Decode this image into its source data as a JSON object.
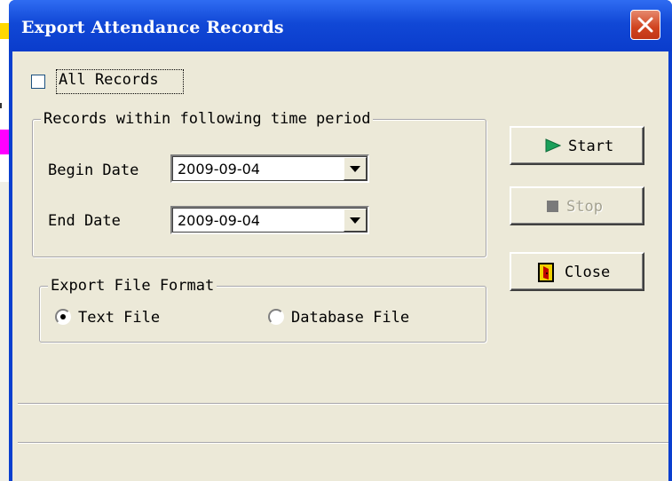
{
  "window": {
    "title": "Export Attendance Records"
  },
  "all_records": {
    "label": "All Records",
    "checked": false
  },
  "time_period": {
    "legend": "Records within following time period",
    "begin_label": "Begin Date",
    "begin_value": "2009-09-04",
    "end_label": "End Date",
    "end_value": "2009-09-04"
  },
  "format": {
    "legend": "Export File Format",
    "options": [
      {
        "label": "Text File",
        "selected": true
      },
      {
        "label": "Database File",
        "selected": false
      }
    ]
  },
  "buttons": {
    "start": "Start",
    "stop": "Stop",
    "close": "Close"
  },
  "colors": {
    "titlebar": "#0a3ccc",
    "dialog_bg": "#ece9d8",
    "start_icon": "#1aa05a",
    "close_button": "#d0431f"
  }
}
